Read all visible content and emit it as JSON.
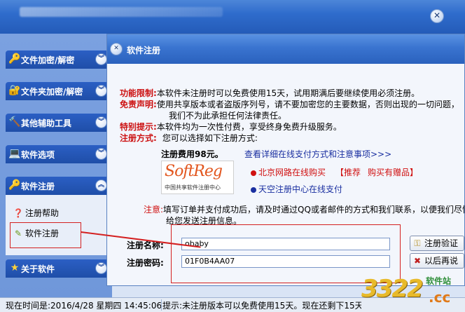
{
  "sidebar": {
    "sections": [
      {
        "label": "文件加密/解密",
        "icon": "key-icon"
      },
      {
        "label": "文件夹加密/解密",
        "icon": "folder-key-icon"
      },
      {
        "label": "其他辅助工具",
        "icon": "hammer-icon"
      },
      {
        "label": "软件选项",
        "icon": "computer-icon"
      },
      {
        "label": "软件注册",
        "icon": "key-icon"
      },
      {
        "label": "关于软件",
        "icon": "star-icon"
      }
    ],
    "sub_items": [
      {
        "label": "注册帮助",
        "icon": "help-icon"
      },
      {
        "label": "软件注册",
        "icon": "register-icon"
      }
    ]
  },
  "dialog": {
    "title": "软件注册",
    "limit_label": "功能限制:",
    "limit_text": "本软件未注册时可以免费使用15天，试用期满后要继续使用必须注册。",
    "disclaimer_label": "免责声明:",
    "disclaimer_text1": "使用共享版本或者盗版序列号，请不要加密您的主要数据，否则出现的一切问题，",
    "disclaimer_text2": "我们不为此承担任何法律责任。",
    "tip_label": "特别提示:",
    "tip_text": "本软件均为一次性付费，享受终身免费升级服务。",
    "method_label": "注册方式:",
    "method_text": "您可以选择如下注册方式:",
    "fee_text": "注册费用98元。",
    "details_link": "查看详细在线支付方式和注意事项>>>",
    "logo_text": "SoftReg",
    "logo_sub": "中国共享软件注册中心",
    "option1": "北京网路在线购买",
    "recommend": "【推荐",
    "gift": "购买有赠品】",
    "option2": "天空注册中心在线支付",
    "note_label": "注意:",
    "note_text1": "填写订单并支付成功后，请及时通过QQ或者邮件的方式和我们联系，以便我们尽快",
    "note_text2": "给您发送注册信息。",
    "reg_name_label": "注册名称:",
    "reg_name_value": "obaby",
    "reg_code_label": "注册密码:",
    "reg_code_value": "01F0B4AA07",
    "verify_button": "注册验证",
    "later_button": "以后再说"
  },
  "status": {
    "time_text": "现在时间是:2016/4/28 星期四 14:45:06",
    "tip_text": "提示:未注册版本可以免费使用15天。现在还剩下15天。"
  },
  "watermark": {
    "number": "3322",
    "site": "软件站",
    "domain": ".cc"
  },
  "colors": {
    "accent": "#2b5fc4",
    "warning": "#cc1111",
    "link": "#1a2fa0"
  }
}
